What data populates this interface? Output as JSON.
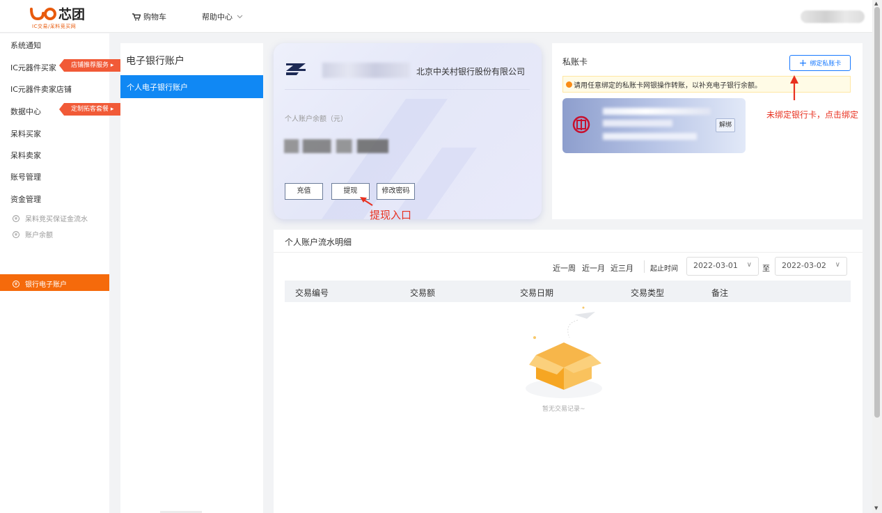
{
  "header": {
    "logo_text": "芯团",
    "logo_subtitle": "IC交易/呆料竞买网",
    "cart_label": "购物车",
    "help_label": "帮助中心"
  },
  "sidebar": {
    "items": [
      {
        "label": "系统通知"
      },
      {
        "label": "IC元器件买家",
        "tag": "店铺推荐服务 ▸"
      },
      {
        "label": "IC元器件卖家店铺"
      },
      {
        "label": "数据中心",
        "tag": "定制拓客套餐 ▸"
      },
      {
        "label": "呆料买家"
      },
      {
        "label": "呆料卖家"
      },
      {
        "label": "账号管理"
      },
      {
        "label": "资金管理"
      }
    ],
    "sub_items": [
      {
        "label": "呆料竞买保证金流水",
        "icon": "money-icon"
      },
      {
        "label": "账户余额",
        "icon": "money-icon"
      },
      {
        "label": "银行电子账户",
        "icon": "money-icon",
        "active": true
      }
    ]
  },
  "accounts": {
    "title": "电子银行账户",
    "selected": "个人电子银行账户"
  },
  "card": {
    "bank_name": "北京中关村银行股份有限公司",
    "balance_label": "个人账户余额（元）",
    "recharge_label": "充值",
    "withdraw_label": "提现",
    "change_pwd_label": "修改密码",
    "annotation": "提现入口"
  },
  "private_card": {
    "title": "私账卡",
    "bind_label": "绑定私账卡",
    "notice": "请用任意绑定的私账卡网银操作转账，以补充电子银行余额。",
    "unbind_label": "解绑",
    "annotation": "未绑定银行卡，点击绑定"
  },
  "records": {
    "title": "个人账户流水明细",
    "quick_ranges": [
      "近一周",
      "近一月",
      "近三月"
    ],
    "range_label": "起止时间",
    "start_date": "2022-03-01",
    "to_label": "至",
    "end_date": "2022-03-02",
    "columns": [
      "交易编号",
      "交易额",
      "交易日期",
      "交易类型",
      "备注"
    ],
    "empty_text": "暂无交易记录~"
  },
  "colors": {
    "accent_orange": "#f56a0b",
    "accent_blue": "#1088f4",
    "annotation_red": "#e8301f",
    "tag_red": "#f15a37"
  }
}
